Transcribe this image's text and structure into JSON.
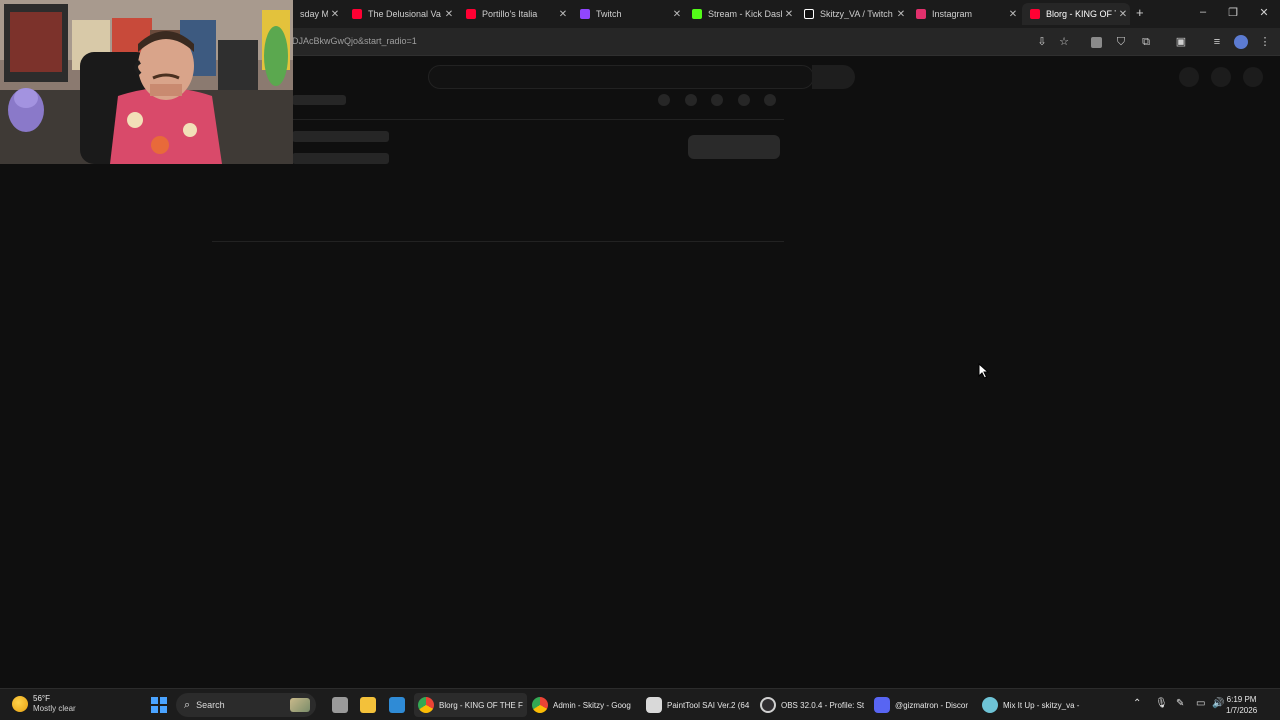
{
  "browser": {
    "tabs": [
      {
        "title": "sday M",
        "favicon_color": "#ff0033"
      },
      {
        "title": "The Delusional Va",
        "favicon_color": "#ff0033"
      },
      {
        "title": "Portillo's Italia",
        "favicon_color": "#ff0033"
      },
      {
        "title": "Twitch",
        "favicon_color": "#9146ff"
      },
      {
        "title": "Stream - Kick Dash",
        "favicon_color": "#53fc18"
      },
      {
        "title": "Skitzy_VA / Twitch",
        "favicon_color": "#ffffff"
      },
      {
        "title": "Instagram",
        "favicon_color": "#e1306c"
      },
      {
        "title": "Blorg - KING OF T",
        "favicon_color": "#ff0033"
      }
    ],
    "new_tab_label": "+",
    "window_controls": [
      "–",
      "❐",
      "✕"
    ],
    "url": "DJAcBkwGwQjo&start_radio=1"
  },
  "taskbar": {
    "weather": {
      "temp": "56°F",
      "condition": "Mostly clear"
    },
    "search_label": "Search",
    "apps": [
      {
        "label": "Blorg - KING OF THE F",
        "icon": "chrome-icon",
        "color": "#4caf50"
      },
      {
        "label": "Admin - Skitzy - Goog",
        "icon": "chrome-icon",
        "color": "#4caf50"
      },
      {
        "label": "PaintTool SAI Ver.2 (64",
        "icon": "painttool-icon",
        "color": "#d9d9d9"
      },
      {
        "label": "OBS 32.0.4 - Profile: St",
        "icon": "obs-icon",
        "color": "#302e31"
      },
      {
        "label": "@gizmatron - Discor",
        "icon": "discord-icon",
        "color": "#5865f2"
      },
      {
        "label": "Mix It Up - skitzy_va -",
        "icon": "mixitup-icon",
        "color": "#6ec3d6"
      }
    ],
    "time": "6:19 PM",
    "date": "1/7/2026"
  }
}
